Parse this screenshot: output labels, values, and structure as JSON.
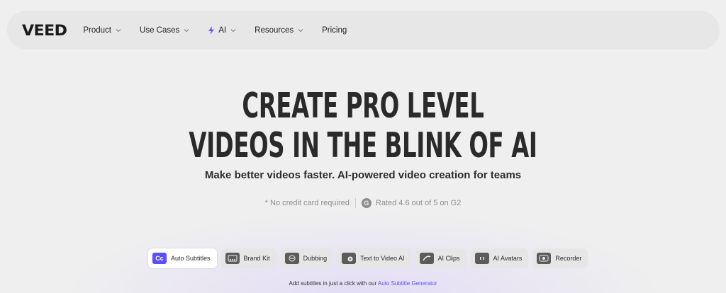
{
  "nav": {
    "logo": "VEED",
    "items": [
      {
        "label": "Product"
      },
      {
        "label": "Use Cases"
      },
      {
        "label": "AI"
      },
      {
        "label": "Resources"
      },
      {
        "label": "Pricing"
      }
    ]
  },
  "hero": {
    "title_line1": "CREATE PRO LEVEL",
    "title_line2": "VIDEOS IN THE BLINK OF AI",
    "subtitle": "Make better videos faster. AI-powered video creation for teams"
  },
  "meta": {
    "no_card": "* No credit card required",
    "g2_badge": "G",
    "rating": "Rated 4.6 out of 5 on G2"
  },
  "tabs": [
    {
      "label": "Auto Subtitles",
      "icon": "Cc",
      "active": true
    },
    {
      "label": "Brand Kit"
    },
    {
      "label": "Dubbing"
    },
    {
      "label": "Text to Video AI"
    },
    {
      "label": "AI Clips"
    },
    {
      "label": "AI Avatars"
    },
    {
      "label": "Recorder"
    }
  ],
  "caption": {
    "text": "Add subtitles in just a click with our",
    "link": "Auto Subtitle Generator"
  },
  "colors": {
    "accent": "#5b4ff5",
    "background": "#efefef",
    "nav_bg": "#e7e7e7"
  }
}
